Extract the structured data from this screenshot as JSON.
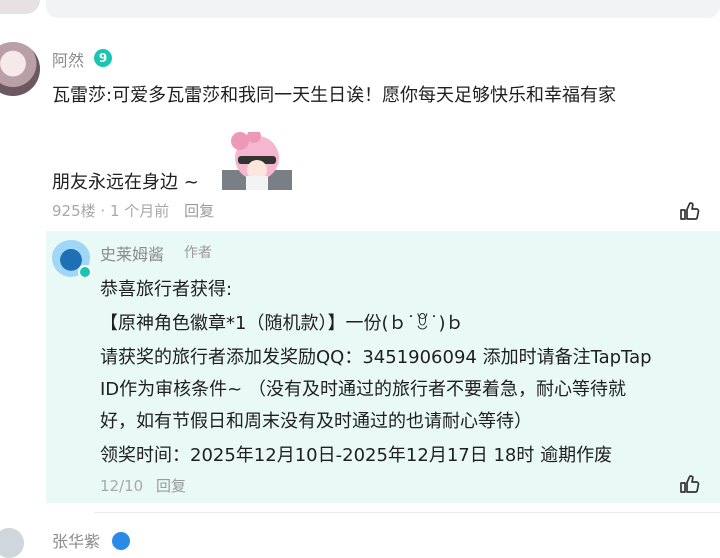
{
  "top_comment_partial": "",
  "comment": {
    "username": "阿然",
    "level": "9",
    "lines": [
      "瓦雷莎:可爱多瓦雷莎和我同一天生日诶！愿你每天足够快乐和幸福有家",
      "朋友永远在身边 ~"
    ],
    "floor": "925楼",
    "separator": "·",
    "time": "1 个月前",
    "reply_label": "回复"
  },
  "reply": {
    "username": "史莱姆酱",
    "author_tag": "作者",
    "lines": [
      "恭喜旅行者获得:",
      "【原神角色徽章*1（随机款）】一份(ｂ˙ꆚ˙)ｂ",
      "请获奖的旅行者添加发奖励QQ：3451906094 添加时请备注TapTap",
      "ID作为审核条件~ （没有及时通过的旅行者不要着急，耐心等待就",
      "好，如有节假日和周末没有及时通过的也请耐心等待）",
      "领奖时间：2025年12月10日-2025年12月17日 18时 逾期作废"
    ],
    "date": "12/10",
    "reply_label": "回复"
  },
  "next_comment": {
    "username": "张华紫"
  },
  "colors": {
    "accent": "#19c6b1",
    "reply_bg": "#e9f9f6",
    "meta_text": "#a8a8a8"
  }
}
